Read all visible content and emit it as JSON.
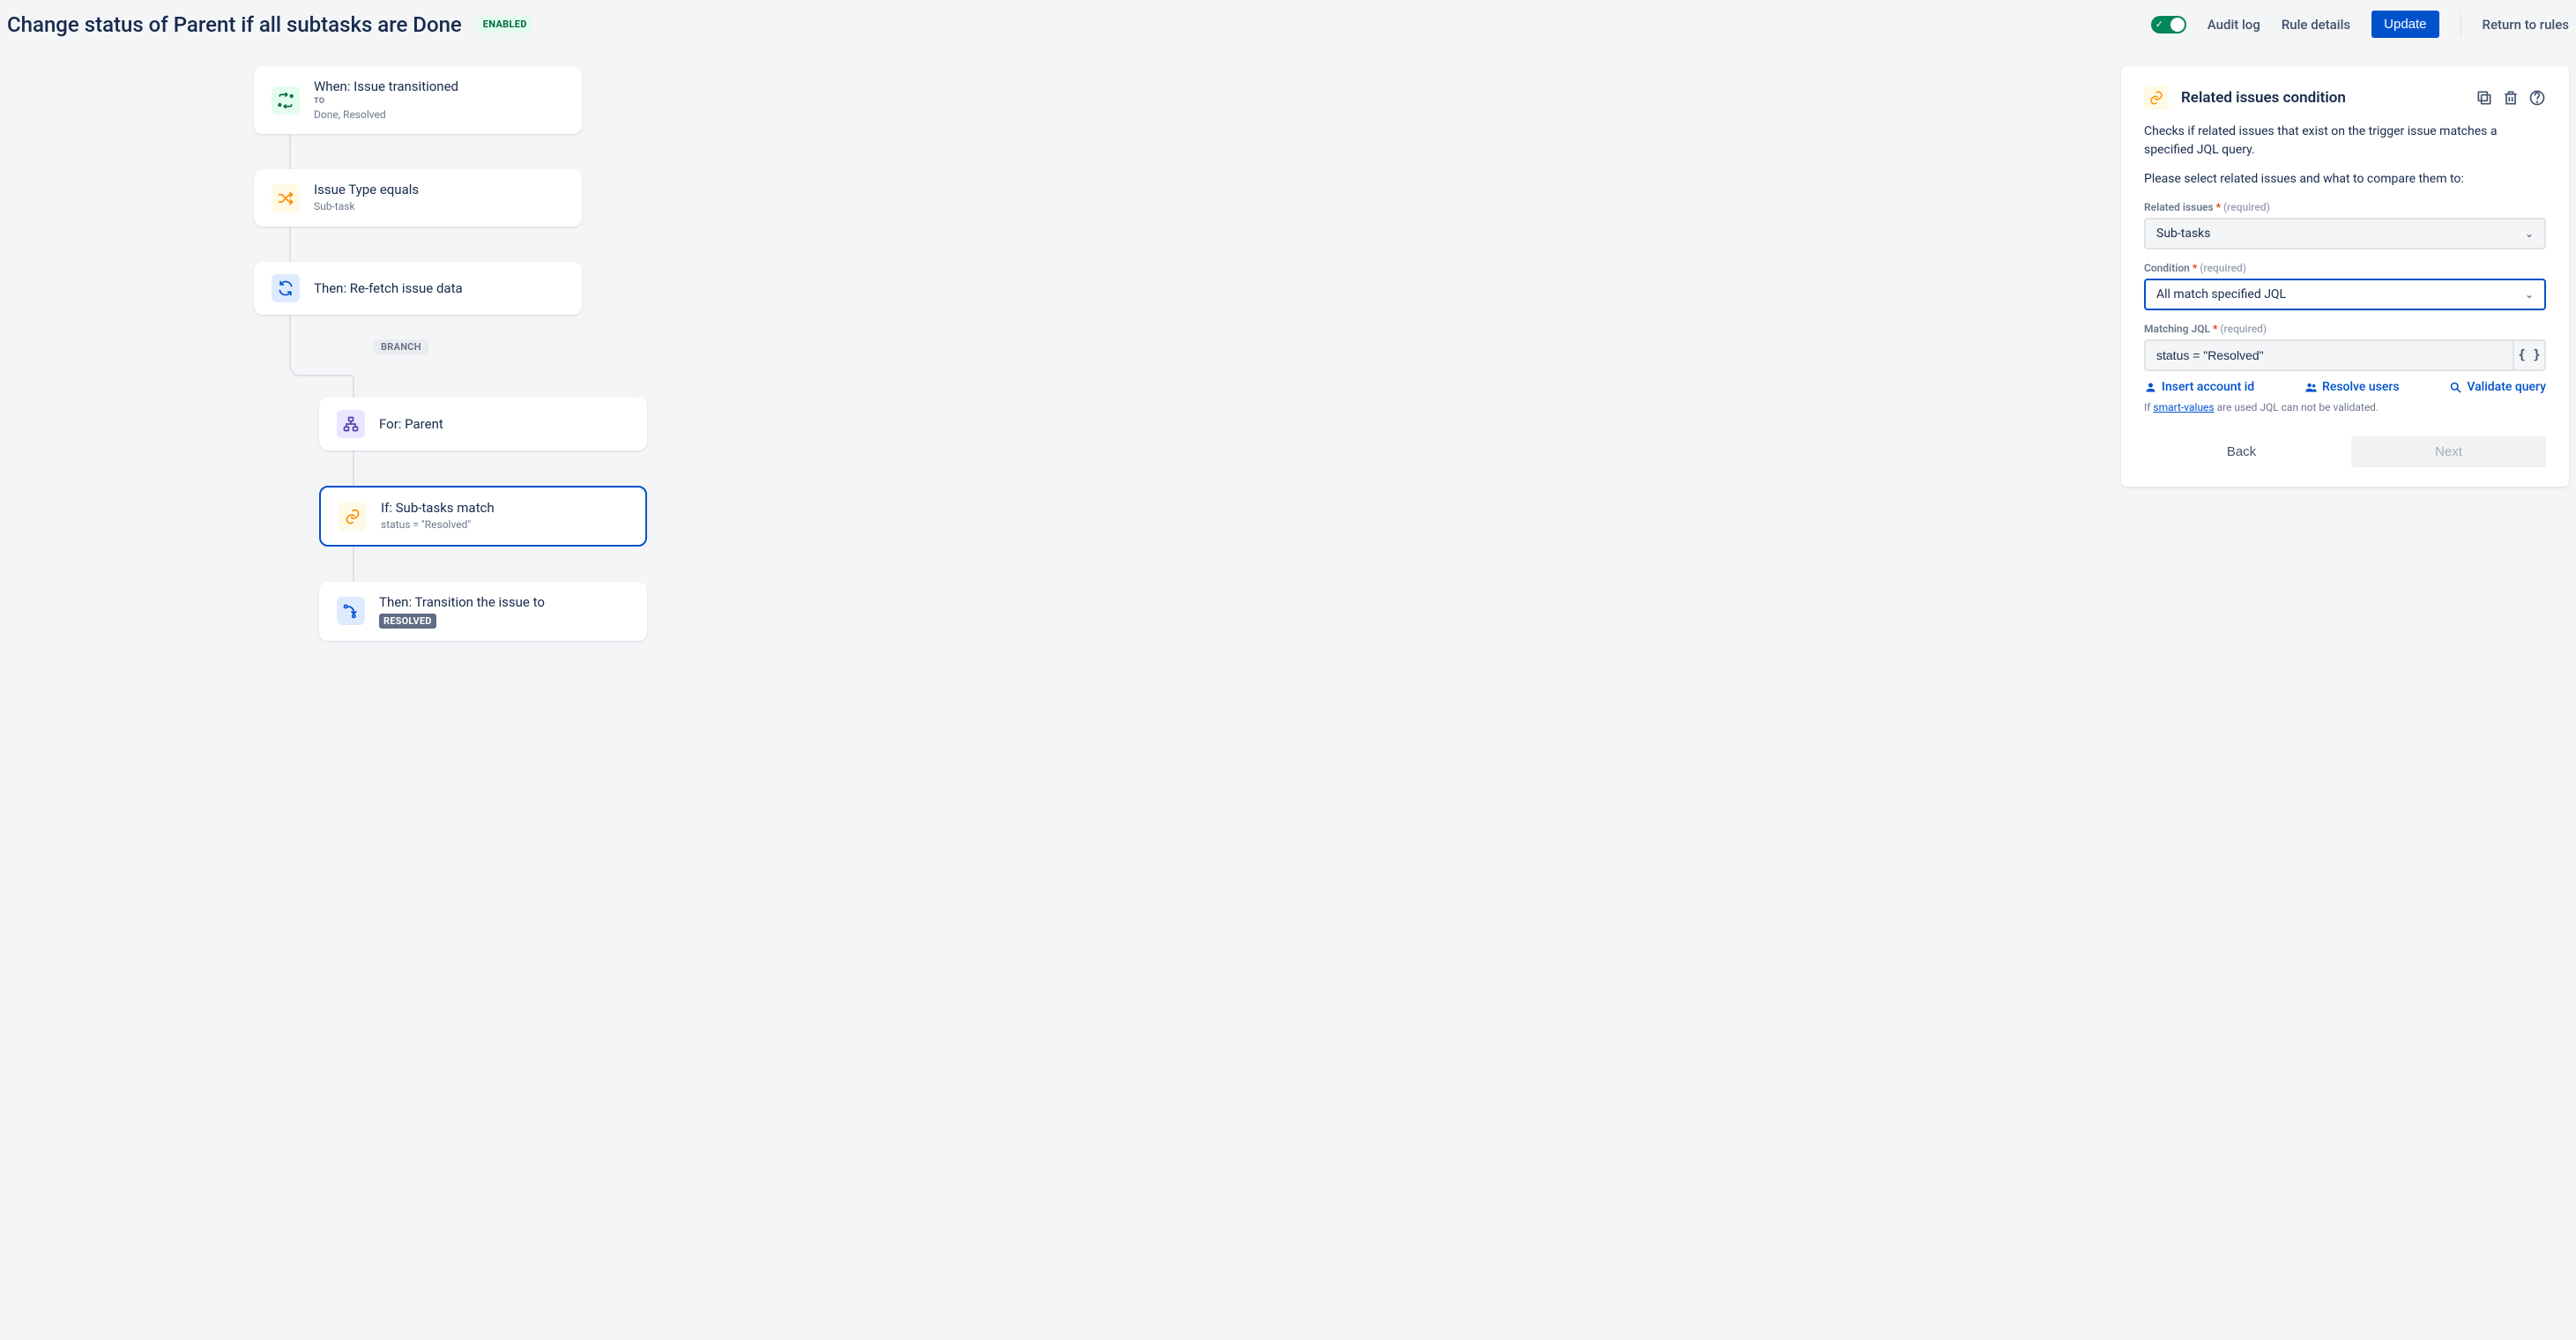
{
  "header": {
    "title": "Change status of Parent if all subtasks are Done",
    "status_badge": "ENABLED",
    "audit_log": "Audit log",
    "rule_details": "Rule details",
    "update": "Update",
    "return": "Return to rules"
  },
  "flow": {
    "branch_label": "BRANCH",
    "cards": [
      {
        "id": "trigger",
        "title": "When: Issue transitioned",
        "sub_label": "TO",
        "sub_value": "Done, Resolved"
      },
      {
        "id": "cond-type",
        "title": "Issue Type equals",
        "sub_value": "Sub-task"
      },
      {
        "id": "refetch",
        "title": "Then: Re-fetch issue data"
      },
      {
        "id": "branch",
        "title": "For: Parent"
      },
      {
        "id": "cond-match",
        "title": "If: Sub-tasks match",
        "sub_value": "status = \"Resolved\""
      },
      {
        "id": "transition",
        "title": "Then: Transition the issue to",
        "lozenge": "RESOLVED"
      }
    ]
  },
  "panel": {
    "title": "Related issues condition",
    "description": "Checks if related issues that exist on the trigger issue matches a specified JQL query.",
    "prompt": "Please select related issues and what to compare them to:",
    "required_text": "(required)",
    "fields": {
      "related_issues": {
        "label": "Related issues",
        "value": "Sub-tasks"
      },
      "condition": {
        "label": "Condition",
        "value": "All match specified JQL"
      },
      "matching_jql": {
        "label": "Matching JQL",
        "value": "status = \"Resolved\""
      }
    },
    "helpers": {
      "insert_account": "Insert account id",
      "resolve_users": "Resolve users",
      "validate_query": "Validate query",
      "smart_values_note_prefix": "If ",
      "smart_values_link": "smart-values",
      "smart_values_note_suffix": " are used JQL can not be validated."
    },
    "buttons": {
      "back": "Back",
      "next": "Next"
    },
    "jql_braces": "{ }"
  }
}
